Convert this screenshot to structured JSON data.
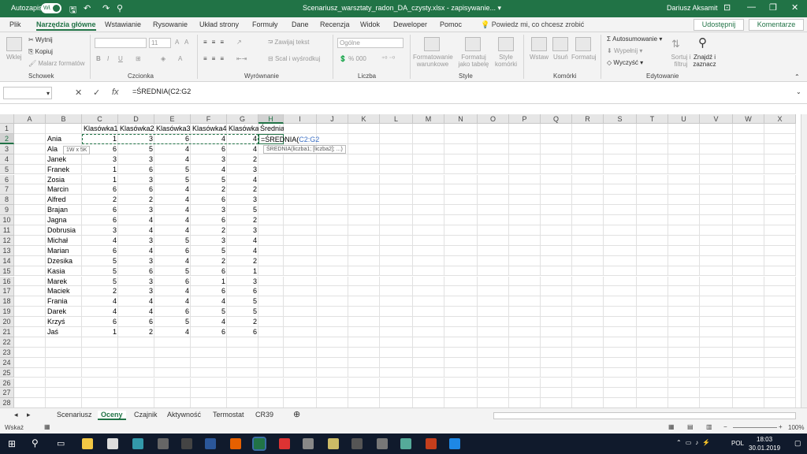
{
  "titlebar": {
    "autosave_label": "Autozapis",
    "autosave_state": "Wł.",
    "title": "Scenariusz_warsztaty_radon_DA_czysty.xlsx - zapisywanie... ▾",
    "user": "Dariusz Aksamit"
  },
  "tabs": [
    "Plik",
    "Narzędzia główne",
    "Wstawianie",
    "Rysowanie",
    "Układ strony",
    "Formuły",
    "Dane",
    "Recenzja",
    "Widok",
    "Deweloper",
    "Pomoc"
  ],
  "tell_me": "Powiedz mi, co chcesz zrobić",
  "share_label": "Udostępnij",
  "comments_label": "Komentarze",
  "ribbon": {
    "clipboard": {
      "paste": "Wklej",
      "cut": "Wytnij",
      "copy": "Kopiuj",
      "format_painter": "Malarz formatów",
      "label": "Schowek"
    },
    "font": {
      "label": "Czcionka",
      "size": "11",
      "bold": "B",
      "italic": "I",
      "underline": "U"
    },
    "alignment": {
      "wrap": "Zawijaj tekst",
      "merge": "Scal i wyśrodkuj",
      "label": "Wyrównanie"
    },
    "number": {
      "format": "Ogólne",
      "label": "Liczba"
    },
    "styles": {
      "conditional": "Formatowanie warunkowe",
      "table": "Formatuj jako tabelę",
      "cell_styles": "Style komórki",
      "label": "Style"
    },
    "cells": {
      "insert": "Wstaw",
      "delete": "Usuń",
      "format": "Formatuj",
      "label": "Komórki"
    },
    "editing": {
      "autosum": "Autosumowanie",
      "fill": "Wypełnij",
      "clear": "Wyczyść",
      "sort": "Sortuj i filtruj",
      "find": "Znajdź i zaznacz",
      "label": "Edytowanie"
    }
  },
  "formula_bar": {
    "formula": "=ŚREDNIA(C2:G2"
  },
  "columns": [
    "A",
    "B",
    "C",
    "D",
    "E",
    "F",
    "G",
    "H",
    "I",
    "J",
    "K",
    "L",
    "M",
    "N",
    "O",
    "P",
    "Q",
    "R",
    "S",
    "T",
    "U",
    "V",
    "W",
    "X"
  ],
  "rows": [
    "1",
    "2",
    "3",
    "4",
    "5",
    "6",
    "7",
    "8",
    "9",
    "10",
    "11",
    "12",
    "13",
    "14",
    "15",
    "16",
    "17",
    "18",
    "19",
    "20",
    "21",
    "22",
    "23",
    "24",
    "25",
    "26",
    "27",
    "28"
  ],
  "headers": [
    "Klasówka1",
    "Klasówka2",
    "Klasówka3",
    "Klasówka4",
    "Klasówka5",
    "Średnia"
  ],
  "edit_cell": {
    "prefix": "=ŚREDNIA(",
    "ref": "C2:G2"
  },
  "size_tip": "1W x 5K",
  "func_tip": "ŚREDNIA(liczba1; [liczba2]; ...)",
  "table": [
    {
      "name": "Ania",
      "v": [
        "1",
        "3",
        "6",
        "4",
        "4"
      ]
    },
    {
      "name": "Ala",
      "v": [
        "6",
        "5",
        "4",
        "6",
        "4"
      ]
    },
    {
      "name": "Janek",
      "v": [
        "3",
        "3",
        "4",
        "3",
        "2"
      ]
    },
    {
      "name": "Franek",
      "v": [
        "1",
        "6",
        "5",
        "4",
        "3"
      ]
    },
    {
      "name": "Zosia",
      "v": [
        "1",
        "3",
        "5",
        "5",
        "4"
      ]
    },
    {
      "name": "Marcin",
      "v": [
        "6",
        "6",
        "4",
        "2",
        "2"
      ]
    },
    {
      "name": "Alfred",
      "v": [
        "2",
        "2",
        "4",
        "6",
        "3"
      ]
    },
    {
      "name": "Brajan",
      "v": [
        "6",
        "3",
        "4",
        "3",
        "5"
      ]
    },
    {
      "name": "Jagna",
      "v": [
        "6",
        "4",
        "4",
        "6",
        "2"
      ]
    },
    {
      "name": "Dobrusia",
      "v": [
        "3",
        "4",
        "4",
        "2",
        "3"
      ]
    },
    {
      "name": "Michał",
      "v": [
        "4",
        "3",
        "5",
        "3",
        "4"
      ]
    },
    {
      "name": "Marian",
      "v": [
        "6",
        "4",
        "6",
        "5",
        "4"
      ]
    },
    {
      "name": "Dzesika",
      "v": [
        "5",
        "3",
        "4",
        "2",
        "2"
      ]
    },
    {
      "name": "Kasia",
      "v": [
        "5",
        "6",
        "5",
        "6",
        "1"
      ]
    },
    {
      "name": "Marek",
      "v": [
        "5",
        "3",
        "6",
        "1",
        "3"
      ]
    },
    {
      "name": "Maciek",
      "v": [
        "2",
        "3",
        "4",
        "6",
        "6"
      ]
    },
    {
      "name": "Frania",
      "v": [
        "4",
        "4",
        "4",
        "4",
        "5"
      ]
    },
    {
      "name": "Darek",
      "v": [
        "4",
        "4",
        "6",
        "5",
        "5"
      ]
    },
    {
      "name": "Krzyś",
      "v": [
        "6",
        "6",
        "5",
        "4",
        "2"
      ]
    },
    {
      "name": "Jaś",
      "v": [
        "1",
        "2",
        "4",
        "6",
        "6"
      ]
    }
  ],
  "sheets": [
    "Scenariusz",
    "Oceny",
    "Czajnik",
    "Aktywność",
    "Termostat",
    "CR39"
  ],
  "active_sheet": "Oceny",
  "status": {
    "mode": "Wskaż",
    "zoom": "100%"
  },
  "taskbar": {
    "lang": "POL",
    "time": "18:03",
    "date": "30.01.2019"
  },
  "colors": {
    "excel_green": "#217346",
    "taskbar": "#101a2c"
  }
}
